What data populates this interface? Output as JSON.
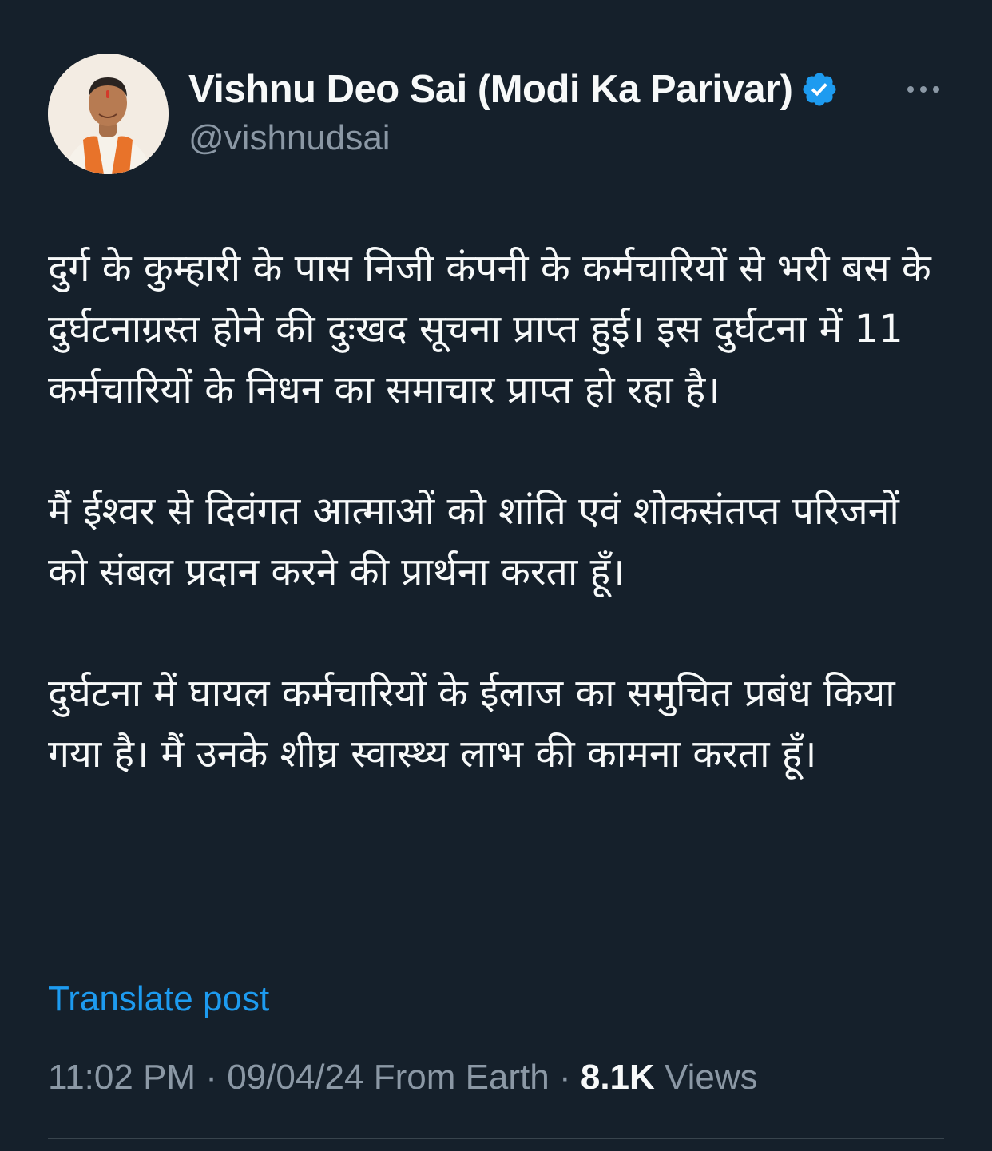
{
  "author": {
    "display_name": "Vishnu Deo Sai (Modi Ka Parivar)",
    "handle": "@vishnudsai",
    "verified_icon": "verified-badge-icon",
    "avatar_icon": "avatar"
  },
  "post": {
    "paragraphs": [
      "दुर्ग के कुम्हारी के पास निजी कंपनी के कर्मचारियों से भरी बस के दुर्घटनाग्रस्त होने की दुःखद सूचना प्राप्त हुई। इस दुर्घटना में 11 कर्मचारियों के निधन का समाचार प्राप्त हो रहा है।",
      "मैं ईश्वर से दिवंगत आत्माओं को शांति एवं शोकसंतप्त परिजनों को संबल प्रदान करने की प्रार्थना करता हूँ।",
      "दुर्घटना में घायल कर्मचारियों के ईलाज का समुचित प्रबंध किया गया है। मैं उनके शीघ्र स्वास्थ्य लाभ की कामना करता हूँ।"
    ],
    "translate_label": "Translate post"
  },
  "meta": {
    "time": "11:02 PM",
    "separator": " · ",
    "date": "09/04/24",
    "source": "From Earth",
    "views_count": "8.1K",
    "views_label": "Views"
  },
  "colors": {
    "background": "#15202b",
    "primary_text": "#f7f9f9",
    "secondary_text": "#8b98a5",
    "accent": "#1d9bf0",
    "divider": "#38444d"
  }
}
